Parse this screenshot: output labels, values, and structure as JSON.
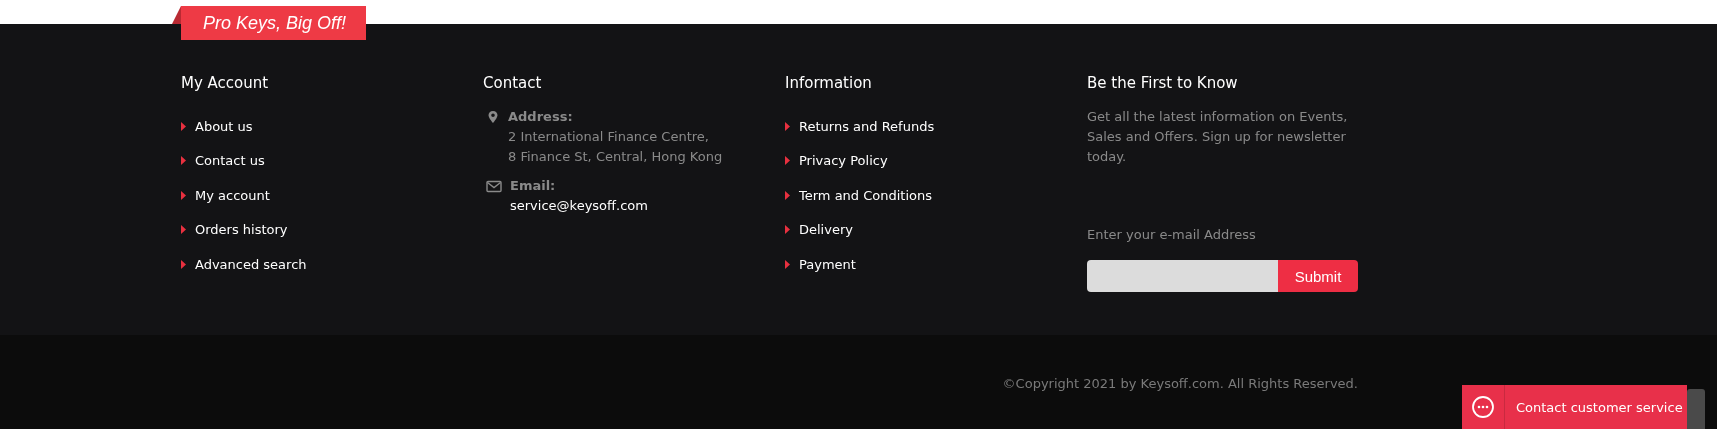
{
  "tag": "Pro Keys, Big Off!",
  "columns": [
    {
      "kind": "links",
      "title": "My Account",
      "links": [
        "About us",
        "Contact us",
        "My account",
        "Orders history",
        "Advanced search"
      ]
    },
    {
      "kind": "contact",
      "title": "Contact",
      "entries": [
        {
          "kind": "address",
          "label": "Address:",
          "lines": [
            "2 International Finance Centre,",
            "8 Finance St, Central, Hong Kong"
          ]
        },
        {
          "kind": "email",
          "label": "Email:",
          "lines": [
            "service@keysoff.com"
          ]
        }
      ]
    },
    {
      "kind": "links",
      "title": "Information",
      "links": [
        "Returns and Refunds",
        "Privacy Policy",
        "Term and Conditions",
        "Delivery",
        "Payment"
      ]
    },
    {
      "kind": "newsletter",
      "title": "Be the First to Know",
      "text": "Get all the latest information on Events, Sales and Offers. Sign up for newsletter today.",
      "field_label": "Enter your e-mail Address",
      "button": "Submit"
    }
  ],
  "copyright": "©Copyright 2021 by Keysoff.com. All Rights Reserved.",
  "chat_button": "Contact customer service"
}
